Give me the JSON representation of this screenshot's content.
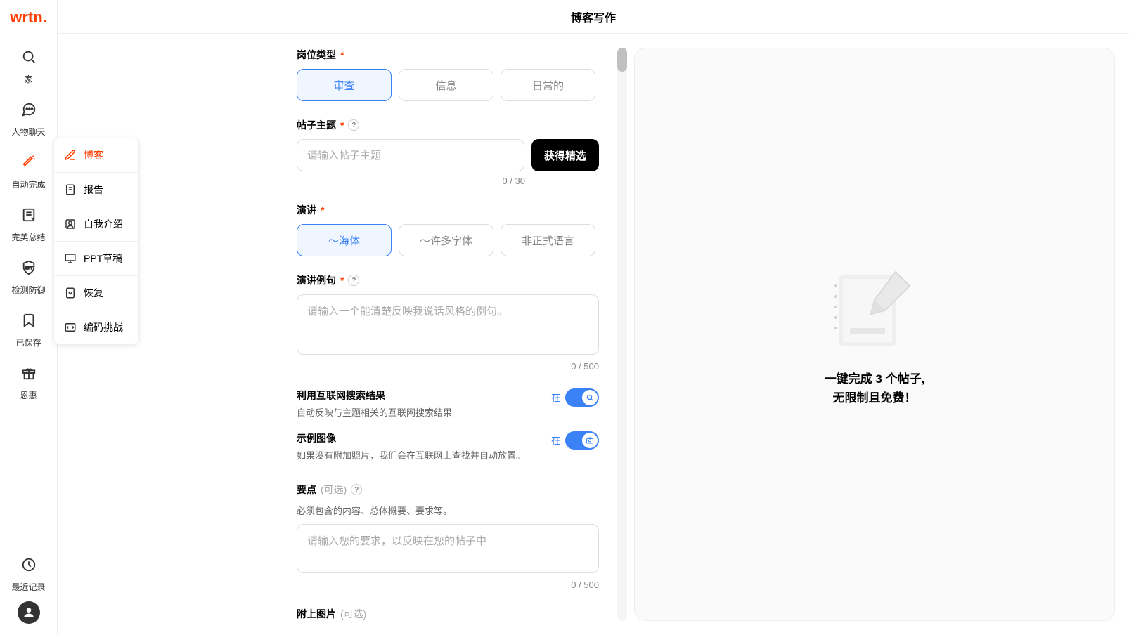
{
  "header": {
    "title": "博客写作"
  },
  "logo": "wrtn.",
  "nav": [
    {
      "icon": "search",
      "label": "家"
    },
    {
      "icon": "chat",
      "label": "人物聊天"
    },
    {
      "icon": "wand",
      "label": "自动完成",
      "active": true
    },
    {
      "icon": "summary",
      "label": "完美总结"
    },
    {
      "icon": "shield",
      "label": "检测防御"
    },
    {
      "icon": "bookmark",
      "label": "已保存"
    },
    {
      "icon": "gift",
      "label": "恩惠"
    }
  ],
  "nav_bottom": {
    "label": "最近记录"
  },
  "submenu": [
    {
      "label": "博客",
      "active": true
    },
    {
      "label": "报告"
    },
    {
      "label": "自我介绍"
    },
    {
      "label": "PPT草稿"
    },
    {
      "label": "恢复"
    },
    {
      "label": "编码挑战"
    }
  ],
  "form": {
    "job_type": {
      "label": "岗位类型",
      "options": [
        "审查",
        "信息",
        "日常的"
      ],
      "selected": 0
    },
    "topic": {
      "label": "帖子主题",
      "placeholder": "请输入帖子主题",
      "button": "获得精选",
      "counter": "0 / 30"
    },
    "speech": {
      "label": "演讲",
      "options": [
        "～海体",
        "～许多字体",
        "非正式语言"
      ],
      "selected": 0
    },
    "example": {
      "label": "演讲例句",
      "placeholder": "请输入一个能清楚反映我说话风格的例句。",
      "counter": "0 / 500"
    },
    "search": {
      "title": "利用互联网搜索结果",
      "desc": "自动反映与主题相关的互联网搜索结果",
      "state": "在"
    },
    "image": {
      "title": "示例图像",
      "desc": "如果没有附加照片，我们会在互联网上查找并自动放置。",
      "state": "在"
    },
    "points": {
      "label": "要点",
      "optional": "(可选)",
      "desc": "必须包含的内容、总体概要、要求等。",
      "placeholder": "请输入您的要求，以反映在您的帖子中",
      "counter": "0 / 500"
    },
    "attach": {
      "label": "附上图片",
      "optional": "(可选)"
    }
  },
  "preview": {
    "line1": "一键完成 3 个帖子,",
    "line2": "无限制且免费！"
  }
}
